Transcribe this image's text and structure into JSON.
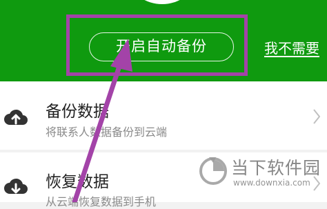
{
  "header": {
    "primary_button": "开启自动备份",
    "secondary_link": "我不需要"
  },
  "list": {
    "items": [
      {
        "title": "备份数据",
        "subtitle": "将联系人数据备份到云端",
        "icon": "cloud-upload-icon"
      },
      {
        "title": "恢复数据",
        "subtitle": "从云端恢复数据到手机",
        "icon": "cloud-download-icon"
      }
    ]
  },
  "watermark": {
    "name": "当下软件园",
    "url": "www.downxia.com"
  },
  "annotation": {
    "highlight_color": "#a343a8",
    "arrow_color": "#a343a8"
  },
  "colors": {
    "header_green": "#0f9a0f"
  }
}
